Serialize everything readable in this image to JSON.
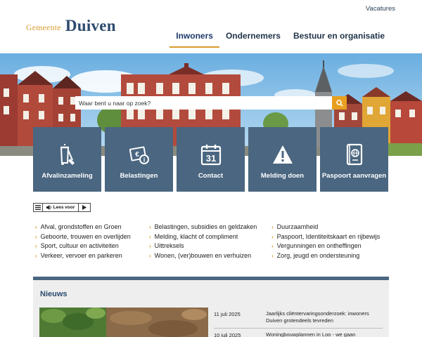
{
  "header": {
    "top_link": "Vacatures",
    "logo_prefix": "Gemeente",
    "logo_name": "Duiven",
    "nav": [
      {
        "label": "Inwoners",
        "active": true
      },
      {
        "label": "Ondernemers",
        "active": false
      },
      {
        "label": "Bestuur en organisatie",
        "active": false
      }
    ]
  },
  "search": {
    "placeholder": "Waar bent u naar op zoek?",
    "button_icon": "search-icon"
  },
  "tiles": [
    {
      "label": "Afvalinzameling",
      "icon": "waste-bin-icon"
    },
    {
      "label": "Belastingen",
      "icon": "tax-money-icon"
    },
    {
      "label": "Contact",
      "icon": "calendar-31-icon",
      "icon_text": "31"
    },
    {
      "label": "Melding doen",
      "icon": "warning-icon"
    },
    {
      "label": "Paspoort aanvragen",
      "icon": "passport-icon"
    }
  ],
  "readspeaker": {
    "label": "Lees voor"
  },
  "topics": {
    "col1": [
      "Afval, grondstoffen en Groen",
      "Geboorte, trouwen en overlijden",
      "Sport, cultuur en activiteiten",
      "Verkeer, vervoer en parkeren"
    ],
    "col2": [
      "Belastingen, subsidies en geldzaken",
      "Melding, klacht of compliment",
      "Uittreksels",
      "Wonen, (ver)bouwen en verhuizen"
    ],
    "col3": [
      "Duurzaamheid",
      "Paspoort, Identiteitskaart en rijbewijs",
      "Vergunningen en ontheffingen",
      "Zorg, jeugd en ondersteuning"
    ]
  },
  "news": {
    "heading": "Nieuws",
    "items": [
      {
        "date": "11 juli 2025",
        "title": "Jaarlijks cliëntervaringsonderzoek: inwoners Duiven grotendeels tevreden"
      },
      {
        "date": "10 juli 2025",
        "title": "Woningbouwplannen in Loo - we gaan"
      }
    ]
  },
  "colors": {
    "accent": "#d89a2a",
    "tile": "#4a6680",
    "brand": "#2c4a6e",
    "search_button": "#e8a021"
  }
}
